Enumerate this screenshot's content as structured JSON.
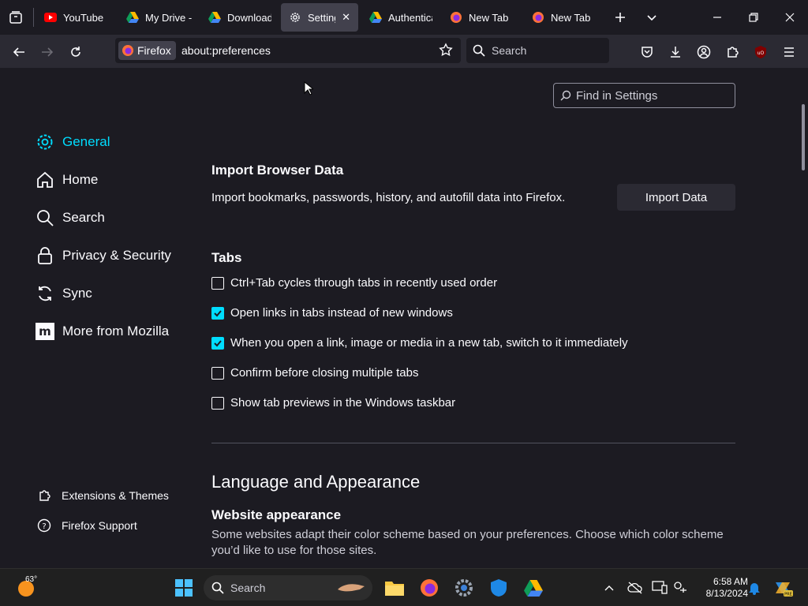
{
  "tabs": [
    {
      "label": "YouTube",
      "icon": "youtube-icon"
    },
    {
      "label": "My Drive -",
      "icon": "google-drive-icon"
    },
    {
      "label": "Download",
      "icon": "google-drive-icon"
    },
    {
      "label": "Settings",
      "icon": "gear-icon",
      "active": true
    },
    {
      "label": "Authentica",
      "icon": "google-drive-icon"
    },
    {
      "label": "New Tab",
      "icon": "firefox-icon"
    },
    {
      "label": "New Tab",
      "icon": "firefox-icon"
    }
  ],
  "navbar": {
    "identity_label": "Firefox",
    "url": "about:preferences",
    "search_placeholder": "Search"
  },
  "find_placeholder": "Find in Settings",
  "categories": [
    {
      "label": "General",
      "icon": "gear-icon",
      "selected": true
    },
    {
      "label": "Home",
      "icon": "home-icon"
    },
    {
      "label": "Search",
      "icon": "search-icon"
    },
    {
      "label": "Privacy & Security",
      "icon": "lock-icon"
    },
    {
      "label": "Sync",
      "icon": "sync-icon"
    },
    {
      "label": "More from Mozilla",
      "icon": "mozilla-icon"
    }
  ],
  "footer": {
    "extensions": "Extensions & Themes",
    "support": "Firefox Support"
  },
  "import": {
    "title": "Import Browser Data",
    "description": "Import bookmarks, passwords, history, and autofill data into Firefox.",
    "button": "Import Data"
  },
  "tabs_section": {
    "title": "Tabs",
    "options": [
      {
        "label": "Ctrl+Tab cycles through tabs in recently used order",
        "checked": false
      },
      {
        "label": "Open links in tabs instead of new windows",
        "checked": true
      },
      {
        "label": "When you open a link, image or media in a new tab, switch to it immediately",
        "checked": true
      },
      {
        "label": "Confirm before closing multiple tabs",
        "checked": false
      },
      {
        "label": "Show tab previews in the Windows taskbar",
        "checked": false
      }
    ]
  },
  "language": {
    "title": "Language and Appearance",
    "web_appearance_title": "Website appearance",
    "web_appearance_desc": "Some websites adapt their color scheme based on your preferences. Choose which color scheme you’d like to use for those sites."
  },
  "taskbar": {
    "temperature": "63°",
    "search_placeholder": "Search",
    "time": "6:58 AM",
    "date": "8/13/2024"
  },
  "colors": {
    "accent": "#00ddff",
    "background": "#1c1b22",
    "toolbar": "#2b2a33"
  }
}
